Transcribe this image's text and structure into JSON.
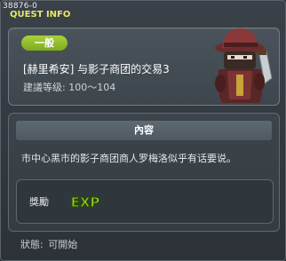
{
  "window": {
    "quest_id": "38876-0",
    "title": "QUEST INFO"
  },
  "quest": {
    "category": "一般",
    "name": "[赫里希安] 与影子商团的交易3",
    "level_text": "建議等级: 100～104",
    "npc_icon": "shadow-merchant-portrait"
  },
  "content": {
    "header": "內容",
    "text": "市中心黑市的影子商团商人罗梅洛似乎有话要说。"
  },
  "reward": {
    "label": "獎勵",
    "icon": "exp-icon",
    "icon_text": "EXP"
  },
  "status": {
    "label": "狀態:",
    "value": "可開始"
  },
  "colors": {
    "title_yellow": "#e6e86a",
    "badge_green": "#8fbf2a",
    "exp_green": "#9ad81c"
  }
}
